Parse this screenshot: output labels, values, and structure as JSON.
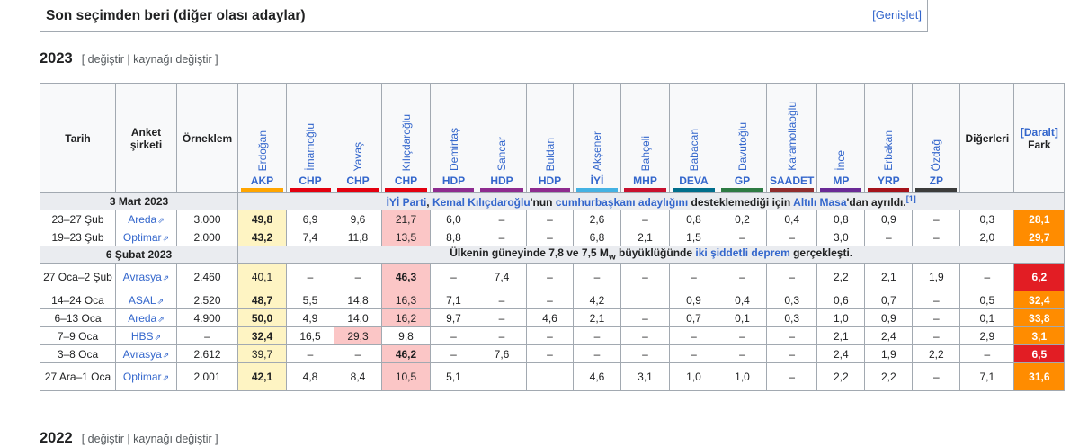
{
  "collapsed_box": {
    "title": "Son seçimden beri (diğer olası adaylar)",
    "expand": "[Genişlet]"
  },
  "sections": {
    "s2023": {
      "title": "2023",
      "edit": "[ değiştir | kaynağı değiştir ]"
    },
    "s2022": {
      "title": "2022",
      "edit": "[ değiştir | kaynağı değiştir ]"
    }
  },
  "table": {
    "headers": {
      "date": "Tarih",
      "firm": "Anket şirketi",
      "sample": "Örneklem",
      "others": "Diğerleri",
      "collapse": "[Daralt]",
      "lead": "Fark"
    },
    "candidates": [
      {
        "name": "Erdoğan",
        "party": "AKP",
        "color": "#ffa500"
      },
      {
        "name": "İmamoğlu",
        "party": "CHP",
        "color": "#e3000f"
      },
      {
        "name": "Yavaş",
        "party": "CHP",
        "color": "#e3000f"
      },
      {
        "name": "Kılıçdaroğlu",
        "party": "CHP",
        "color": "#e3000f"
      },
      {
        "name": "Demirtaş",
        "party": "HDP",
        "color": "#8e2b8f"
      },
      {
        "name": "Sancar",
        "party": "HDP",
        "color": "#8e2b8f"
      },
      {
        "name": "Buldan",
        "party": "HDP",
        "color": "#8e2b8f"
      },
      {
        "name": "Akşener",
        "party": "İYİ",
        "color": "#44b2e3"
      },
      {
        "name": "Bahçeli",
        "party": "MHP",
        "color": "#c8102e"
      },
      {
        "name": "Babacan",
        "party": "DEVA",
        "color": "#006e8c"
      },
      {
        "name": "Davutoğlu",
        "party": "GP",
        "color": "#2d7b43"
      },
      {
        "name": "Karamollaoğlu",
        "party": "SAADET",
        "color": "#912d2e"
      },
      {
        "name": "İnce",
        "party": "MP",
        "color": "#6a2a96"
      },
      {
        "name": "Erbakan",
        "party": "YRP",
        "color": "#a4121a"
      },
      {
        "name": "Özdağ",
        "party": "ZP",
        "color": "#3c3c3b"
      }
    ],
    "note1": {
      "date": "3 Mart 2023",
      "pre": "",
      "l1": "İYİ Parti",
      "t1": ", ",
      "l2": "Kemal Kılıçdaroğlu",
      "t2": "'nun ",
      "l3": "cumhurbaşkanı adaylığını",
      "t3": " desteklemediği için ",
      "l4": "Altılı Masa",
      "t4": "'dan ayrıldı.",
      "ref": "[1]"
    },
    "rows_a": [
      {
        "date": "23–27 Şub",
        "firm": "Areda",
        "sample": "3.000",
        "v": [
          "49,8",
          "6,9",
          "9,6",
          "21,7",
          "6,0",
          "–",
          "–",
          "2,6",
          "–",
          "0,8",
          "0,2",
          "0,4",
          "0,8",
          "0,9",
          "–"
        ],
        "others": "0,3",
        "lead": "28,1",
        "lead_color": "o"
      },
      {
        "date": "19–23 Şub",
        "firm": "Optimar",
        "sample": "2.000",
        "v": [
          "43,2",
          "7,4",
          "11,8",
          "13,5",
          "8,8",
          "–",
          "–",
          "6,8",
          "2,1",
          "1,5",
          "–",
          "–",
          "3,0",
          "–",
          "–"
        ],
        "others": "2,0",
        "lead": "29,7",
        "lead_color": "o"
      }
    ],
    "note2": {
      "date": "6 Şubat 2023",
      "t1": "Ülkenin güneyinde 7,8 ve 7,5 M",
      "sub": "w",
      "t2": "  büyüklüğünde ",
      "l1": "iki şiddetli deprem",
      "t3": " gerçekleşti."
    },
    "rows_b": [
      {
        "date": "27 Oca–2 Şub",
        "firm": "Avrasya",
        "sample": "2.460",
        "v": [
          "40,1",
          "–",
          "–",
          "46,3",
          "–",
          "7,4",
          "–",
          "–",
          "–",
          "–",
          "–",
          "–",
          "2,2",
          "2,1",
          "1,9"
        ],
        "others": "–",
        "lead": "6,2",
        "lead_color": "rd",
        "lead_idx": 3,
        "tall": true
      },
      {
        "date": "14–24 Oca",
        "firm": "ASAL",
        "sample": "2.520",
        "v": [
          "48,7",
          "5,5",
          "14,8",
          "16,3",
          "7,1",
          "–",
          "–",
          "4,2",
          "",
          "0,9",
          "0,4",
          "0,3",
          "0,6",
          "0,7",
          "–"
        ],
        "others": "0,5",
        "lead": "32,4",
        "lead_color": "o",
        "lead_idx": 0
      },
      {
        "date": "6–13 Oca",
        "firm": "Areda",
        "sample": "4.900",
        "v": [
          "50,0",
          "4,9",
          "14,0",
          "16,2",
          "9,7",
          "–",
          "4,6",
          "2,1",
          "–",
          "0,7",
          "0,1",
          "0,3",
          "1,0",
          "0,9",
          "–"
        ],
        "others": "0,1",
        "lead": "33,8",
        "lead_color": "o",
        "lead_idx": 0
      },
      {
        "date": "7–9 Oca",
        "firm": "HBS",
        "sample": "–",
        "v": [
          "32,4",
          "16,5",
          "29,3",
          "9,8",
          "–",
          "–",
          "–",
          "–",
          "–",
          "–",
          "–",
          "–",
          "2,1",
          "2,4",
          "–"
        ],
        "others": "2,9",
        "lead": "3,1",
        "lead_color": "o",
        "lead_idx": 0,
        "second_idx": 2
      },
      {
        "date": "3–8 Oca",
        "firm": "Avrasya",
        "sample": "2.612",
        "v": [
          "39,7",
          "–",
          "–",
          "46,2",
          "–",
          "7,6",
          "–",
          "–",
          "–",
          "–",
          "–",
          "–",
          "2,4",
          "1,9",
          "2,2"
        ],
        "others": "–",
        "lead": "6,5",
        "lead_color": "rd",
        "lead_idx": 3
      },
      {
        "date": "27 Ara–1 Oca",
        "firm": "Optimar",
        "sample": "2.001",
        "v": [
          "42,1",
          "4,8",
          "8,4",
          "10,5",
          "5,1",
          "",
          "",
          "4,6",
          "3,1",
          "1,0",
          "1,0",
          "–",
          "2,2",
          "2,2",
          "–"
        ],
        "others": "7,1",
        "lead": "31,6",
        "lead_color": "o",
        "lead_idx": 0,
        "tall": true
      }
    ]
  }
}
